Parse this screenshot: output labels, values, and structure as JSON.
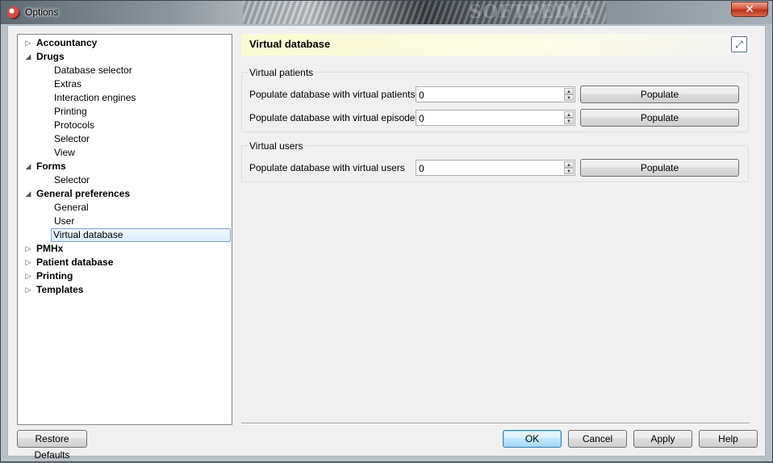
{
  "window": {
    "title": "Options",
    "watermark": "SOFTPEDIA",
    "close_glyph": "✕"
  },
  "tree": {
    "items": [
      {
        "label": "Accountancy",
        "level": 0,
        "expanded": false
      },
      {
        "label": "Drugs",
        "level": 0,
        "expanded": true
      },
      {
        "label": "Database selector",
        "level": 1
      },
      {
        "label": "Extras",
        "level": 1
      },
      {
        "label": "Interaction engines",
        "level": 1
      },
      {
        "label": "Printing",
        "level": 1
      },
      {
        "label": "Protocols",
        "level": 1
      },
      {
        "label": "Selector",
        "level": 1
      },
      {
        "label": "View",
        "level": 1
      },
      {
        "label": "Forms",
        "level": 0,
        "expanded": true
      },
      {
        "label": "Selector",
        "level": 1
      },
      {
        "label": "General preferences",
        "level": 0,
        "expanded": true
      },
      {
        "label": "General",
        "level": 1
      },
      {
        "label": "User",
        "level": 1
      },
      {
        "label": "Virtual database",
        "level": 1,
        "selected": true
      },
      {
        "label": "PMHx",
        "level": 0,
        "expanded": false
      },
      {
        "label": "Patient database",
        "level": 0,
        "expanded": false
      },
      {
        "label": "Printing",
        "level": 0,
        "expanded": false
      },
      {
        "label": "Templates",
        "level": 0,
        "expanded": false
      }
    ],
    "arrow_collapsed": "▷",
    "arrow_expanded": "◢"
  },
  "panel": {
    "title": "Virtual database",
    "maximize_glyph": "⤢",
    "groups": {
      "patients": {
        "title": "Virtual patients",
        "rows": [
          {
            "label": "Populate database with virtual patients",
            "value": "0",
            "button": "Populate"
          },
          {
            "label": "Populate database with virtual episodes",
            "value": "0",
            "button": "Populate"
          }
        ]
      },
      "users": {
        "title": "Virtual users",
        "rows": [
          {
            "label": "Populate database with virtual users",
            "value": "0",
            "button": "Populate"
          }
        ]
      }
    }
  },
  "footer": {
    "restore_defaults": "Restore Defaults",
    "ok": "OK",
    "cancel": "Cancel",
    "apply": "Apply",
    "help": "Help"
  },
  "spin": {
    "up": "▲",
    "down": "▼"
  }
}
